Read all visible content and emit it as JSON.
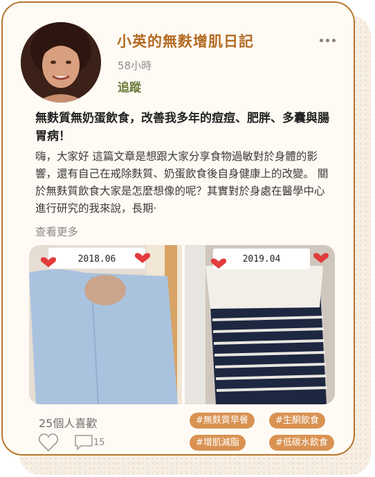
{
  "post": {
    "author": "小英的無麩增肌日記",
    "time": "58小時",
    "follow_label": "追蹤",
    "title": "無麩質無奶蛋飲食，改善我多年的痘痘、肥胖、多囊與腸胃病！",
    "body": "嗨，大家好 這篇文章是想跟大家分享食物過敏對於身體的影響，還有自己在戒除麩質、奶蛋飲食後自身健康上的改變。 關於無麩質飲食大家是怎麼想像的呢？其實對於身處在醫學中心進行研究的我來說，長期·",
    "see_more": "查看更多"
  },
  "photo": {
    "left_label": "2018.06",
    "right_label": "2019.04"
  },
  "footer": {
    "likes": "25個人喜歡",
    "comment_count": "15",
    "tags": [
      "#無麩質早餐",
      "#生酮飲食",
      "#增肌減脂",
      "#低碳水飲食"
    ]
  },
  "icons": {
    "menu": "more-dots-icon",
    "like": "heart-outline-icon",
    "comment": "comment-bubble-icon"
  },
  "colors": {
    "accent": "#b36a22",
    "follow": "#6b7a3a",
    "tag_bg": "#d99252",
    "card_border": "#b7752c"
  }
}
